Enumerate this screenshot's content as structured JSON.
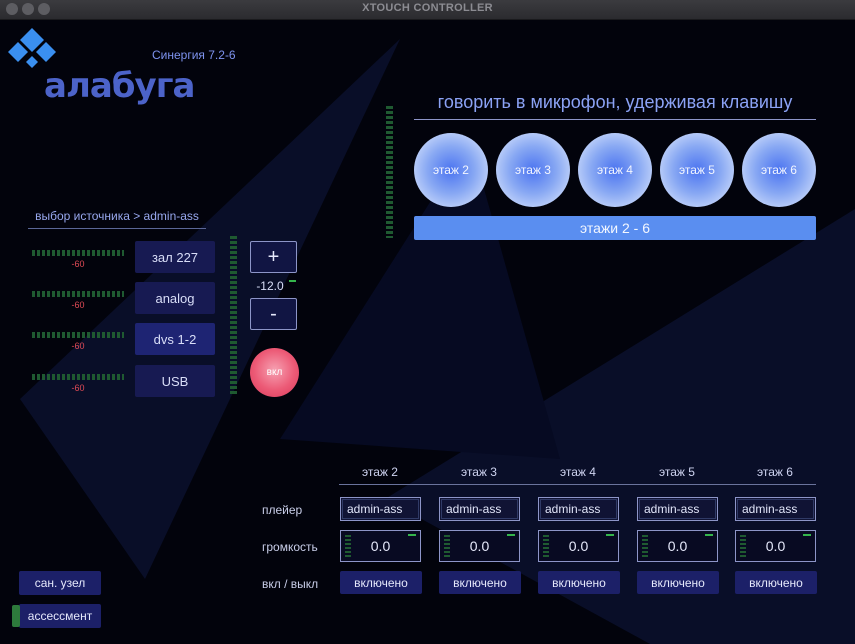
{
  "window": {
    "title": "XTOUCH CONTROLLER"
  },
  "brand": {
    "logo_text": "алабуга",
    "version": "Синергия 7.2-6"
  },
  "source": {
    "header": "выбор источника > admin-ass",
    "items": [
      {
        "label": "зал 227",
        "level": "-60"
      },
      {
        "label": "analog",
        "level": "-60"
      },
      {
        "label": "dvs 1-2",
        "level": "-60"
      },
      {
        "label": "USB",
        "level": "-60"
      }
    ],
    "selected": "dvs 1-2"
  },
  "volume": {
    "plus": "+",
    "minus": "-",
    "value": "-12.0",
    "on_label": "вкл"
  },
  "mic": {
    "title": "говорить в микрофон, удерживая клавишу",
    "floors": [
      "этаж 2",
      "этаж 3",
      "этаж 4",
      "этаж 5",
      "этаж 6"
    ],
    "all_label": "этажи 2 - 6"
  },
  "zones": {
    "row_labels": {
      "player": "плейер",
      "volume": "громкость",
      "toggle": "вкл / выкл"
    },
    "columns": [
      {
        "name": "этаж 2",
        "player": "admin-ass",
        "volume": "0.0",
        "toggle": "включено"
      },
      {
        "name": "этаж 3",
        "player": "admin-ass",
        "volume": "0.0",
        "toggle": "включено"
      },
      {
        "name": "этаж 4",
        "player": "admin-ass",
        "volume": "0.0",
        "toggle": "включено"
      },
      {
        "name": "этаж 5",
        "player": "admin-ass",
        "volume": "0.0",
        "toggle": "включено"
      },
      {
        "name": "этаж 6",
        "player": "admin-ass",
        "volume": "0.0",
        "toggle": "включено"
      }
    ]
  },
  "sidebar": {
    "san_node": "сан. узел",
    "assessment": "ассессмент"
  },
  "colors": {
    "accent": "#5a8ef0",
    "button": "#1c2068",
    "on": "#ec5a76",
    "meter": "#1f5a31"
  }
}
